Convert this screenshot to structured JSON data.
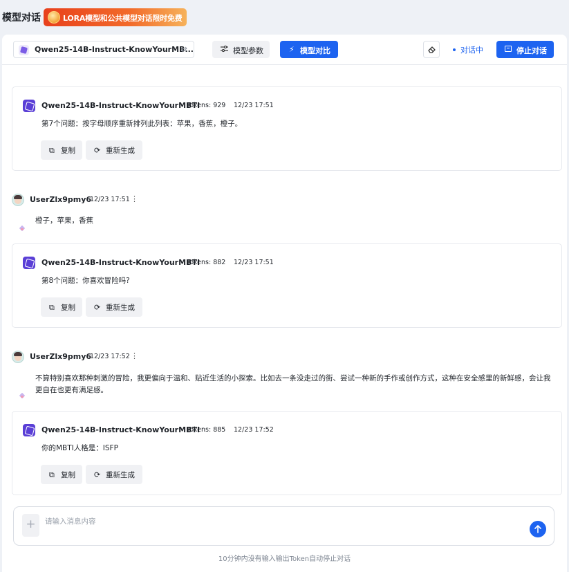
{
  "header": {
    "title": "模型对话",
    "promo_text": "LORA模型和公共模型对话限时免费"
  },
  "toolbar": {
    "model_name": "Qwen25-14B-Instruct-KnowYourMB...",
    "swap_icon": "⇄",
    "params_label": "模型参数",
    "compare_label": "模型对比",
    "status_label": "对话中",
    "stop_label": "停止对话"
  },
  "messages": {
    "bot1": {
      "name": "Qwen25-14B-Instruct-KnowYourMBTI",
      "tokens": "Tokens: 929",
      "time": "12/23 17:51",
      "content": "第7个问题：按字母顺序重新排列此列表：苹果，香蕉，橙子。"
    },
    "user1": {
      "name": "UserZlx9pmy6",
      "time": "12/23 17:51",
      "content": "橙子，苹果，香蕉"
    },
    "bot2": {
      "name": "Qwen25-14B-Instruct-KnowYourMBTI",
      "tokens": "Tokens: 882",
      "time": "12/23 17:51",
      "content": "第8个问题：你喜欢冒险吗?"
    },
    "user2": {
      "name": "UserZlx9pmy6",
      "time": "12/23 17:52",
      "content": "不算特别喜欢那种刺激的冒险，我更偏向于温和、贴近生活的小探索。比如去一条没走过的街、尝试一种新的手作或创作方式，这种在安全感里的新鲜感，会让我更自在也更有满足感。"
    },
    "bot3": {
      "name": "Qwen25-14B-Instruct-KnowYourMBTI",
      "tokens": "Tokens: 885",
      "time": "12/23 17:52",
      "content": "你的MBTI人格是：ISFP"
    }
  },
  "actions": {
    "copy_label": "复制",
    "regen_label": "重新生成",
    "more_icon": "⋮"
  },
  "composer": {
    "placeholder": "请输入消息内容",
    "add_icon": "+"
  },
  "footer": {
    "note": "10分钟内没有输入输出Token自动停止对话"
  },
  "colors": {
    "accent": "#1d63f0",
    "bot_avatar": "#5a3fd6",
    "background": "#eef1f6"
  }
}
